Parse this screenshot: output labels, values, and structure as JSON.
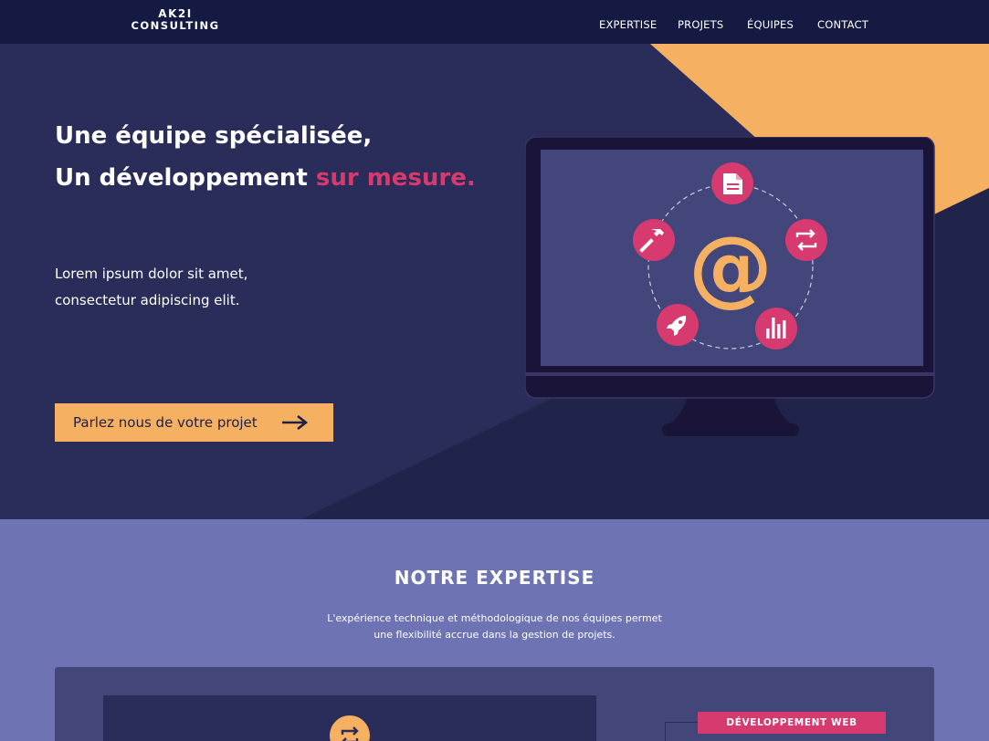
{
  "brand": {
    "line1": "AK2I",
    "line2": "CONSULTING"
  },
  "nav": [
    {
      "label": "EXPERTISE"
    },
    {
      "label": "PROJETS"
    },
    {
      "label": "ÉQUIPES"
    },
    {
      "label": "CONTACT"
    }
  ],
  "hero": {
    "headline_line1": "Une équipe spécialisée,",
    "headline_line2_main": "Un développement ",
    "headline_line2_accent": "sur mesure.",
    "lead_line1": "Lorem ipsum dolor sit amet,",
    "lead_line2": "consectetur adipiscing elit.",
    "cta_label": "Parlez nous de votre projet",
    "monitor_center_symbol": "@",
    "monitor_icons": [
      "document-icon",
      "sync-icon",
      "bar-chart-icon",
      "rocket-icon",
      "hammer-icon"
    ]
  },
  "expertise": {
    "title": "NOTRE EXPERTISE",
    "desc_line1": "L'expérience technique et méthodologique de nos équipes permet",
    "desc_line2": "une flexibilité accrue dans la gestion de projets.",
    "badge": "DÉVELOPPEMENT WEB"
  },
  "colors": {
    "nav_bg": "#141a42",
    "hero_bg": "#2a2d59",
    "hero_dark": "#20244a",
    "accent_orange": "#f5b062",
    "accent_pink": "#d63a6e",
    "screen_bg": "#42467a",
    "expertise_bg": "#6e74b3"
  }
}
